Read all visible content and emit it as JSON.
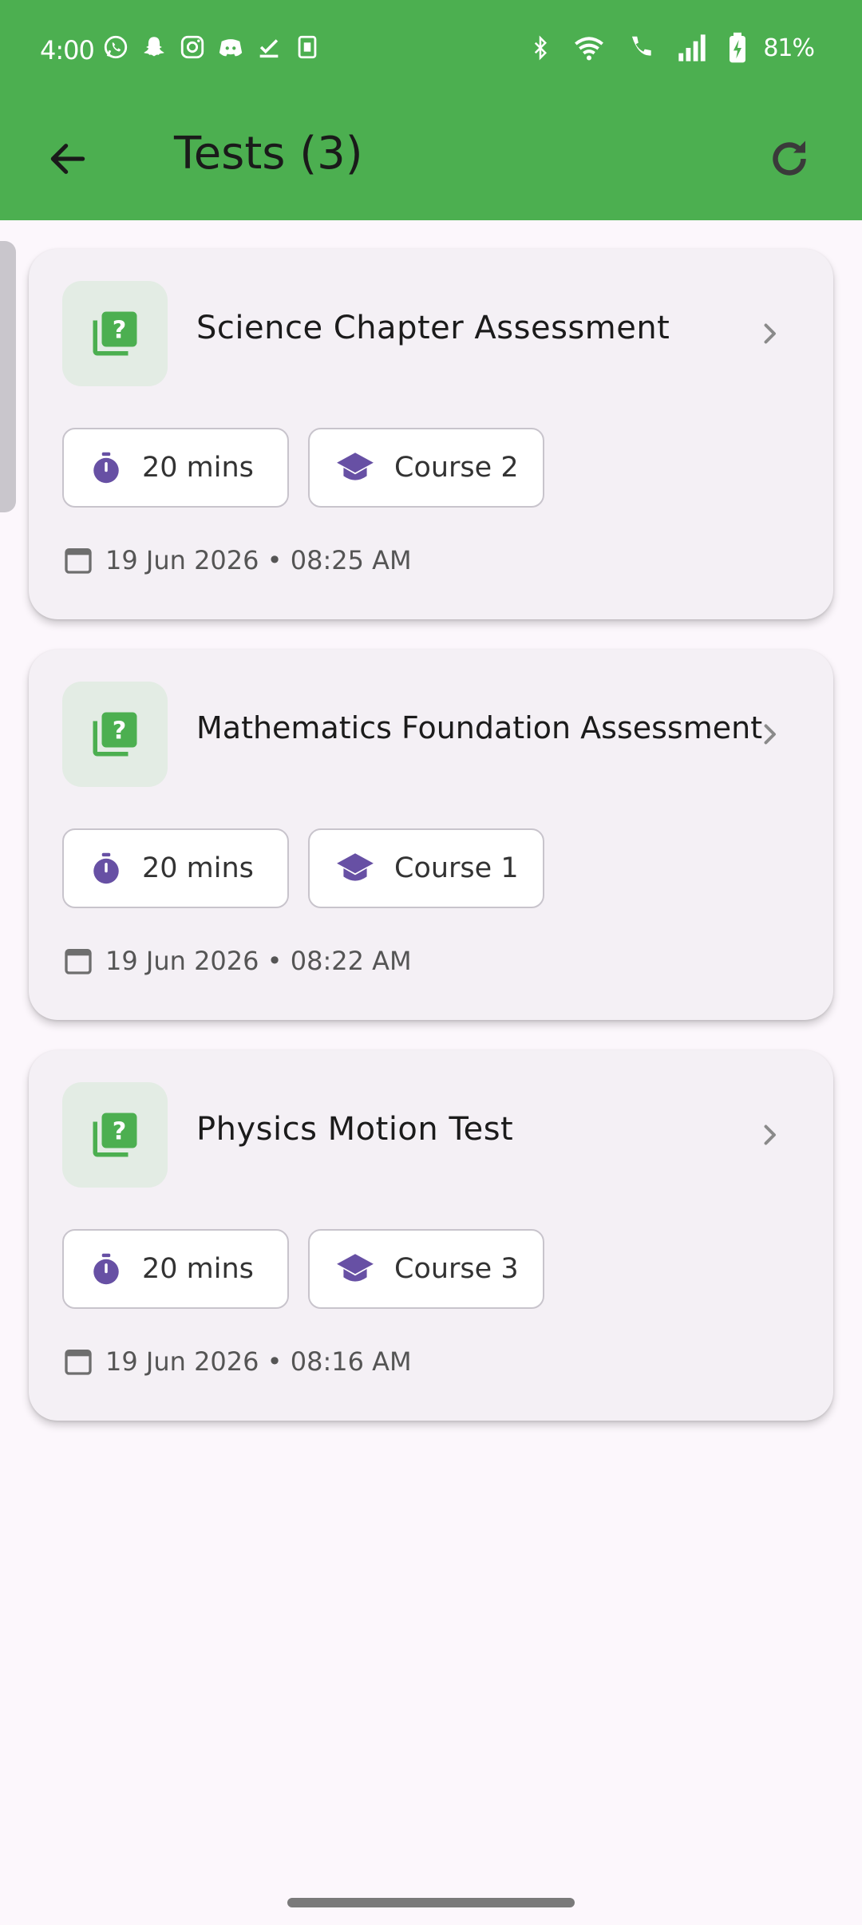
{
  "status_bar": {
    "time": "4:00",
    "battery": "81%"
  },
  "toolbar": {
    "title": "Tests (3)"
  },
  "colors": {
    "appbar": "#4CAF50",
    "accent_purple": "#6750A4",
    "icon_green": "#4CAF50",
    "background": "#FCF7FC"
  },
  "tests": [
    {
      "title": "Science Chapter Assessment",
      "duration": "20 mins",
      "course": "Course 2",
      "date": "19 Jun 2026 • 08:25 AM"
    },
    {
      "title": "Mathematics Foundation Assessment",
      "duration": "20 mins",
      "course": "Course 1",
      "date": "19 Jun 2026 • 08:22 AM"
    },
    {
      "title": "Physics Motion Test",
      "duration": "20 mins",
      "course": "Course 3",
      "date": "19 Jun 2026 • 08:16 AM"
    }
  ]
}
